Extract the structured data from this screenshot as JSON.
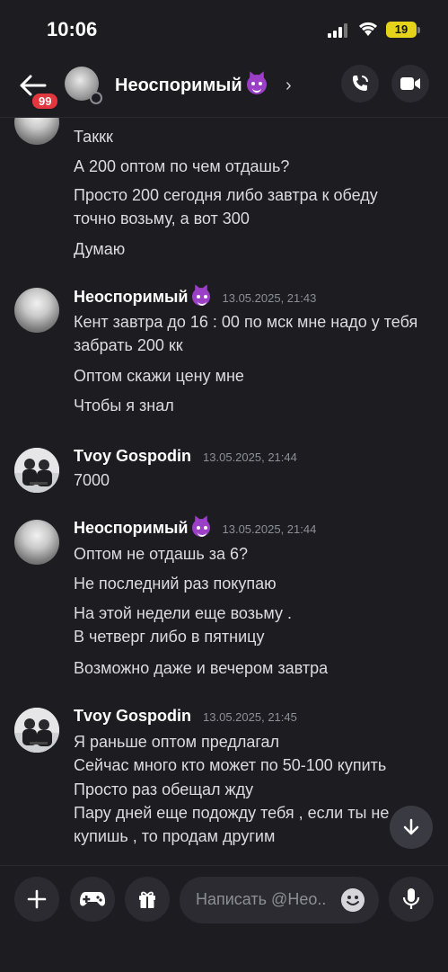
{
  "status_bar": {
    "time": "10:06",
    "battery": "19"
  },
  "header": {
    "unread_badge": "99",
    "title": "Неоспоримый",
    "chevron": "›",
    "icons": [
      "back-arrow-icon",
      "call-icon",
      "video-icon"
    ]
  },
  "messages": {
    "group0": {
      "lines": [
        "Таккк",
        "А 200 оптом по чем отдашь?",
        "Просто 200 сегодня либо завтра к обеду точно возьму, а вот 300",
        "Думаю"
      ]
    },
    "group1": {
      "author": "Неоспоримый",
      "timestamp": "13.05.2025, 21:43",
      "lines": [
        "Кент завтра до 16 : 00 по мск мне надо у тебя забрать 200 кк",
        "Оптом скажи цену мне",
        "Чтобы я знал"
      ]
    },
    "group2": {
      "author": "Tvoy Gospodin",
      "timestamp": "13.05.2025, 21:44",
      "lines": [
        "7000"
      ]
    },
    "group3": {
      "author": "Неоспоримый",
      "timestamp": "13.05.2025, 21:44",
      "lines": [
        "Оптом не отдашь за 6?",
        "Не последний раз покупаю",
        "На этой недели еще возьму .\nВ четверг либо в пятницу",
        "Возможно даже и вечером завтра"
      ]
    },
    "group4": {
      "author": "Tvoy Gospodin",
      "timestamp": "13.05.2025, 21:45",
      "lines": [
        "Я раньше оптом предлагал",
        "Сейчас много кто может по 50-100 купить",
        "Просто раз обещал жду",
        "Пару дней еще подожду тебя , если ты не",
        "купишь , то продам другим"
      ]
    }
  },
  "composer": {
    "placeholder": "Написать @Нео.."
  },
  "colors": {
    "background": "#1c1c21",
    "badge": "#e3373f",
    "accent_emoji": "#9b3fc6",
    "muted": "#8e8e96"
  }
}
